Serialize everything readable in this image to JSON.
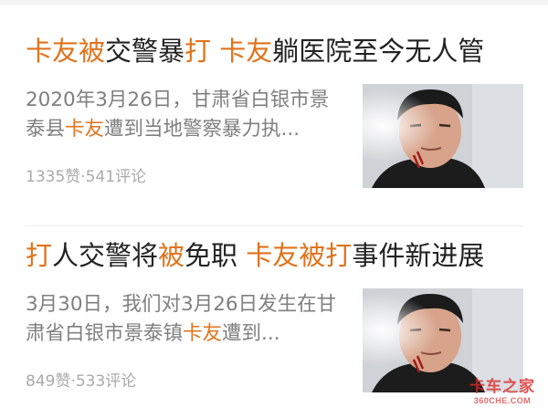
{
  "feed": {
    "items": [
      {
        "title_parts": [
          {
            "text": "卡友",
            "highlight": true
          },
          {
            "text": "被",
            "highlight": true
          },
          {
            "text": "交警暴",
            "highlight": false
          },
          {
            "text": "打",
            "highlight": true
          },
          {
            "text": " ",
            "highlight": false
          },
          {
            "text": "卡友",
            "highlight": true
          },
          {
            "text": "躺医院至今无人管",
            "highlight": false
          }
        ],
        "summary_parts": [
          {
            "text": "2020年3月26日，甘肃省白银市景泰县",
            "highlight": false
          },
          {
            "text": "卡友",
            "highlight": true
          },
          {
            "text": "遭到当地警察暴力执...",
            "highlight": false
          }
        ],
        "likes": "1335赞",
        "comments": "541评论",
        "thumbnail_icon": "person-photo-icon"
      },
      {
        "title_parts": [
          {
            "text": "打",
            "highlight": true
          },
          {
            "text": "人交警将",
            "highlight": false
          },
          {
            "text": "被",
            "highlight": true
          },
          {
            "text": "免职 ",
            "highlight": false
          },
          {
            "text": "卡友",
            "highlight": true
          },
          {
            "text": "被",
            "highlight": true
          },
          {
            "text": "打",
            "highlight": true
          },
          {
            "text": "事件新进展",
            "highlight": false
          }
        ],
        "summary_parts": [
          {
            "text": "3月30日，我们对3月26日发生在甘肃省白银市景泰镇",
            "highlight": false
          },
          {
            "text": "卡友",
            "highlight": true
          },
          {
            "text": "遭到...",
            "highlight": false
          }
        ],
        "likes": "849赞",
        "comments": "533评论",
        "thumbnail_icon": "person-photo-icon"
      }
    ]
  },
  "meta_separator": "·",
  "watermark": {
    "main": "卡车之家",
    "sub": "360CHE.COM"
  },
  "colors": {
    "highlight": "#e0731c",
    "title": "#222222",
    "summary": "#7f7f7f",
    "meta": "#aaaaaa"
  }
}
